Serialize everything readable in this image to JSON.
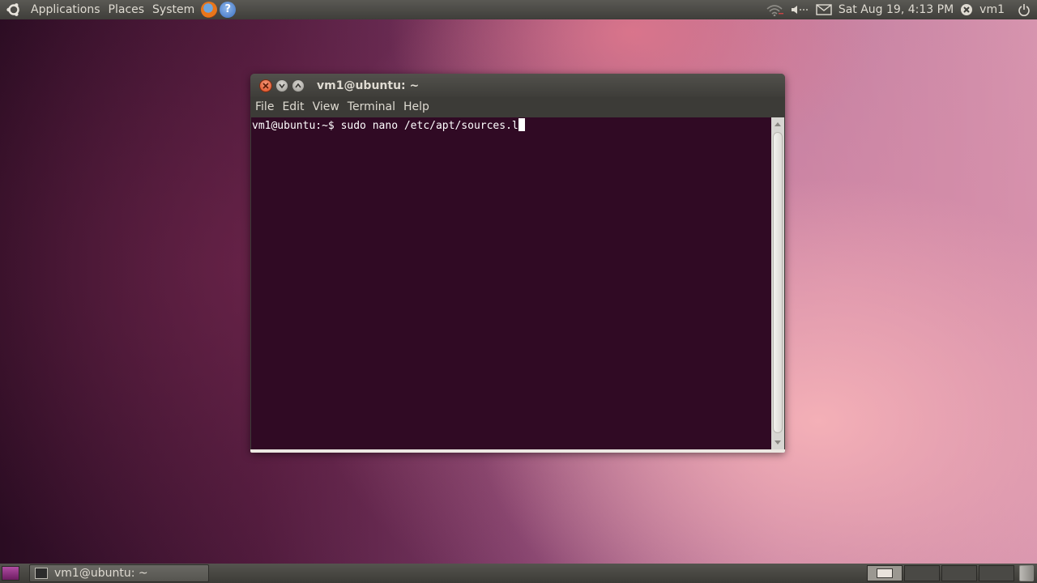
{
  "top_panel": {
    "logo_icon": "ubuntu-logo-icon",
    "menus": [
      "Applications",
      "Places",
      "System"
    ],
    "launchers": [
      "firefox-icon",
      "help-icon"
    ],
    "help_glyph": "?",
    "tray": {
      "network_icon": "wifi-icon",
      "volume_icon": "volume-icon",
      "mail_icon": "mail-icon",
      "clock": "Sat Aug 19,  4:13 PM",
      "user_icon": "user-status-icon",
      "user": "vm1",
      "power_icon": "power-icon"
    }
  },
  "window": {
    "title": "vm1@ubuntu: ~",
    "buttons": [
      "close",
      "minimize",
      "maximize"
    ],
    "menu": [
      "File",
      "Edit",
      "View",
      "Terminal",
      "Help"
    ],
    "terminal": {
      "prompt": "vm1@ubuntu:~$ ",
      "command": "sudo nano /etc/apt/sources.l"
    },
    "colors": {
      "terminal_bg": "#300a24",
      "close_button": "#dc4a1d"
    }
  },
  "bottom_panel": {
    "taskbar_item": "vm1@ubuntu: ~",
    "workspaces": 4,
    "active_workspace": 1
  }
}
